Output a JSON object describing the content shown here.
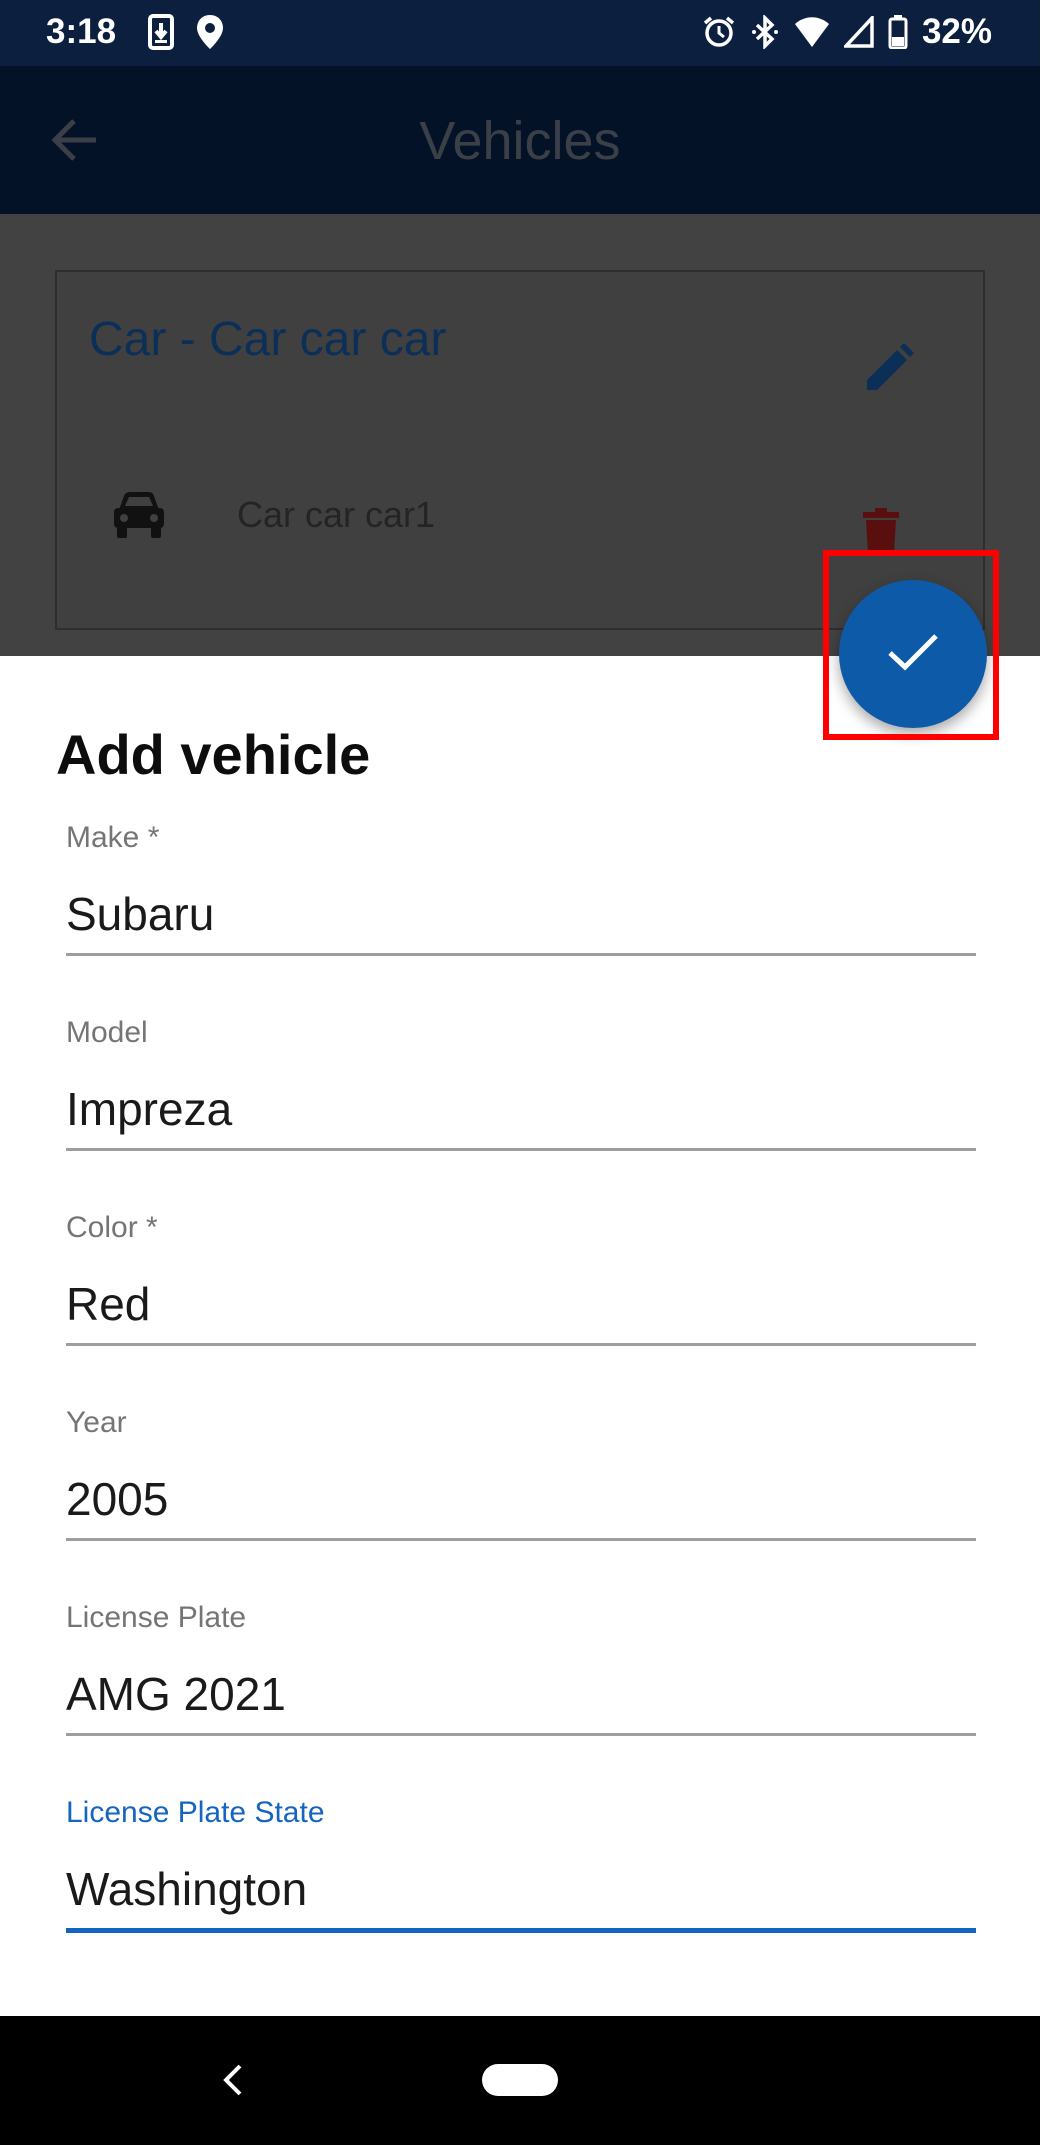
{
  "status_bar": {
    "time": "3:18",
    "battery": "32%",
    "icons": [
      "download-icon",
      "location-icon",
      "alarm-icon",
      "bluetooth-icon",
      "wifi-icon",
      "signal-icon",
      "battery-icon"
    ]
  },
  "background_page": {
    "title": "Vehicles",
    "card": {
      "title": "Car - Car car car",
      "vehicle_name": "Car car car1"
    }
  },
  "sheet": {
    "title": "Add vehicle",
    "fields": [
      {
        "label": "Make *",
        "value": "Subaru"
      },
      {
        "label": "Model",
        "value": "Impreza"
      },
      {
        "label": "Color *",
        "value": "Red"
      },
      {
        "label": "Year",
        "value": "2005"
      },
      {
        "label": "License Plate",
        "value": "AMG 2021"
      },
      {
        "label": "License Plate State",
        "value": "Washington"
      }
    ]
  },
  "colors": {
    "accent": "#1565c0",
    "fab": "#0d5ba8",
    "highlight": "#ff0000",
    "status_bar": "#0c1f3f"
  }
}
